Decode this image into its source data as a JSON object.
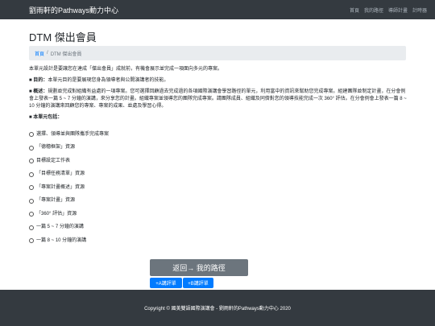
{
  "navbar": {
    "brand": "劉雨軒的Pathways動力中心",
    "links": [
      "首頁",
      "我的路徑",
      "導師計畫",
      "計時器"
    ]
  },
  "page": {
    "title": "DTM 傑出會員"
  },
  "breadcrumb": {
    "home": "首頁",
    "separator": "/",
    "current": "DTM 傑出會員"
  },
  "content": {
    "intro": "本單元設計是要讓您在達成「傑出會員」成就前，有機會展示並完成一項面向多元的專案。",
    "goal_label": "目的：",
    "goal_text": "本單元目的是要展現您身為領導者與公開演講者的技能。",
    "overview_label": "概述：",
    "overview_text": "規劃並完成對組織有益處的一項專案。您可選擇回顧過去完成過的各項國際演講會學習路徑的單元，利用當中的資訊來幫助您完成專案。組建團隊並制定計畫，在分會例會上發表一篇 5 ~ 7 分鐘的演講，來分享您的計畫。組織專案並領導您的團隊完成專案。請團隊成員、組織及同儕對您的領導技能完成一次 360° 評估。在分會例會上發表一篇 8 ~ 10 分鐘的演講來回顧您的專案、專案的成果、並處及學習心得。",
    "includes_label": "本單元包括：",
    "items": [
      "選擇、領導並與團隊攜手完成專案",
      "「德穗框架」資源",
      "目標設定工作表",
      "「目標任務清單」資源",
      "「專案計畫概述」資源",
      "「專案計畫」資源",
      "「360° 評估」資源",
      "一篇 5 ~ 7 分鐘的演講",
      "一篇 8 ~ 10 分鐘的演講"
    ]
  },
  "actions": {
    "back_label": "返回→ 我的路徑",
    "a_label": "+A講評單",
    "b_label": "+B講評單"
  },
  "footer": {
    "text": "Copyright © 國美雙語國際演講會 - 劉雨軒的Pathways動力中心 2020"
  },
  "colors": {
    "navbar_bg": "#343a40",
    "link_blue": "#007bff",
    "back_button": "#6c757d",
    "breadcrumb_bg": "#e9ecef"
  }
}
